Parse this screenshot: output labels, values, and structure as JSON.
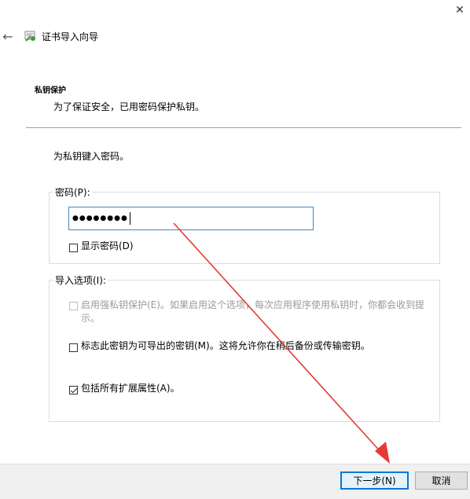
{
  "window": {
    "title": "证书导入向导",
    "close_glyph": "✕",
    "back_glyph": "←"
  },
  "header": {
    "section_title": "私钥保护",
    "section_subtitle": "为了保证安全，已用密码保护私钥。"
  },
  "body": {
    "instruction": "为私钥键入密码。",
    "password_group": {
      "legend": "密码(P):",
      "masked_value": "●●●●●●●●",
      "show_password_label": "显示密码(D)",
      "show_password_checked": false
    },
    "import_options": {
      "legend": "导入选项(I):",
      "options": [
        {
          "label": "启用强私钥保护(E)。如果启用这个选项，每次应用程序使用私钥时，你都会收到提",
          "label_cont": "示。",
          "checked": false,
          "enabled": false
        },
        {
          "label": "标志此密钥为可导出的密钥(M)。这将允许你在稍后备份或传输密钥。",
          "checked": false,
          "enabled": true
        },
        {
          "label": "包括所有扩展属性(A)。",
          "checked": true,
          "enabled": true
        }
      ]
    }
  },
  "footer": {
    "next_label": "下一步(N)",
    "cancel_label": "取消"
  },
  "colors": {
    "accent": "#0078d7",
    "input_border": "#4a82c4",
    "annotation_arrow": "#e53935"
  }
}
